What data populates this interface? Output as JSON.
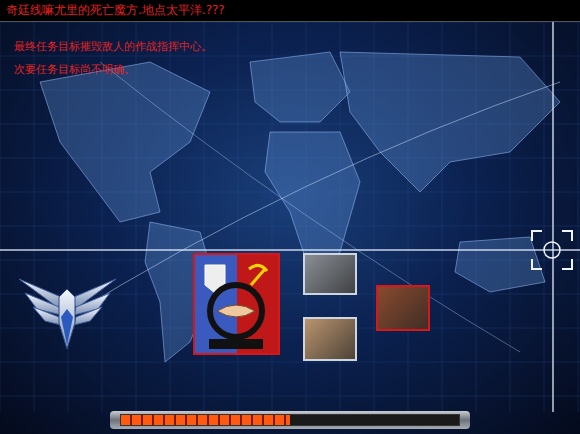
{
  "briefing": {
    "title": "奇廷线嘛尤里的死亡魔方.地点太平洋.???",
    "objectives": [
      "最终任务目标摧毁敌人的作战指挥中心。",
      "次要任务目标尚不明确。"
    ]
  },
  "selection": {
    "items": [
      {
        "kind": "eagle",
        "selected": false
      },
      {
        "kind": "alliance",
        "selected": true
      },
      {
        "kind": "portrait",
        "selected": false,
        "color": "#8a8f96"
      },
      {
        "kind": "portrait",
        "selected": false,
        "color": "#b9946e"
      },
      {
        "kind": "portrait",
        "selected": true,
        "color": "#8a4a2e"
      }
    ]
  },
  "progress": {
    "level": 0.5
  }
}
